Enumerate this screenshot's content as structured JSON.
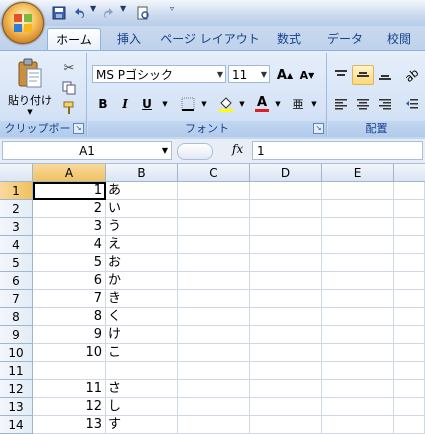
{
  "qat": {
    "save": "save-icon",
    "undo": "undo-icon",
    "redo": "redo-icon",
    "preview": "print-preview-icon"
  },
  "tabs": [
    "ホーム",
    "挿入",
    "ページ レイアウト",
    "数式",
    "データ",
    "校閲"
  ],
  "active_tab": "ホーム",
  "ribbon": {
    "clipboard": {
      "paste_label": "貼り付け",
      "group_label": "クリップボード"
    },
    "font": {
      "name": "MS Pゴシック",
      "size": "11",
      "bold": "B",
      "italic": "I",
      "underline": "U",
      "grow": "A",
      "shrink": "A",
      "color_letter": "A",
      "phonetic": "亜",
      "group_label": "フォント"
    },
    "alignment": {
      "group_label": "配置"
    }
  },
  "formula_bar": {
    "name_box": "A1",
    "fx": "fx",
    "value": "1"
  },
  "columns": [
    "A",
    "B",
    "C",
    "D",
    "E"
  ],
  "rows": [
    {
      "n": "1",
      "a": "1",
      "b": "あ"
    },
    {
      "n": "2",
      "a": "2",
      "b": "い"
    },
    {
      "n": "3",
      "a": "3",
      "b": "う"
    },
    {
      "n": "4",
      "a": "4",
      "b": "え"
    },
    {
      "n": "5",
      "a": "5",
      "b": "お"
    },
    {
      "n": "6",
      "a": "6",
      "b": "か"
    },
    {
      "n": "7",
      "a": "7",
      "b": "き"
    },
    {
      "n": "8",
      "a": "8",
      "b": "く"
    },
    {
      "n": "9",
      "a": "9",
      "b": "け"
    },
    {
      "n": "10",
      "a": "10",
      "b": "こ"
    },
    {
      "n": "11",
      "a": "",
      "b": ""
    },
    {
      "n": "12",
      "a": "11",
      "b": "さ"
    },
    {
      "n": "13",
      "a": "12",
      "b": "し"
    },
    {
      "n": "14",
      "a": "13",
      "b": "す"
    }
  ],
  "colors": {
    "accent": "#15428b",
    "ribbon": "#d5e3f6",
    "selected_header": "#f1c15f"
  }
}
